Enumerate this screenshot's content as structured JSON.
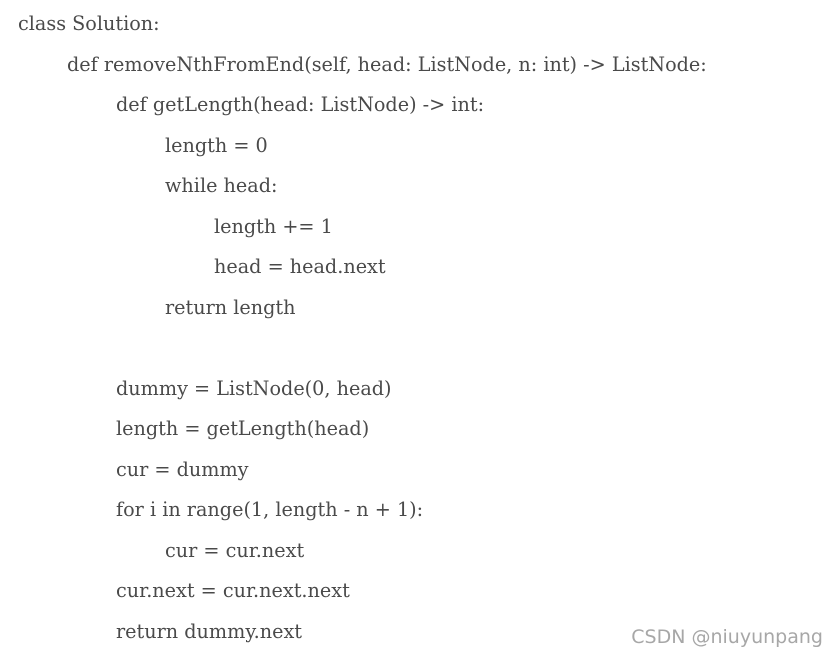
{
  "code": {
    "lines": [
      {
        "text": "class Solution:",
        "indent": 0
      },
      {
        "text": "def removeNthFromEnd(self, head: ListNode, n: int) -> ListNode:",
        "indent": 1
      },
      {
        "text": "def getLength(head: ListNode) -> int:",
        "indent": 2
      },
      {
        "text": "length = 0",
        "indent": 3
      },
      {
        "text": "while head:",
        "indent": 3
      },
      {
        "text": "length += 1",
        "indent": 4
      },
      {
        "text": "head = head.next",
        "indent": 4
      },
      {
        "text": "return length",
        "indent": 3
      },
      {
        "text": "",
        "indent": 0
      },
      {
        "text": "dummy = ListNode(0, head)",
        "indent": 2
      },
      {
        "text": "length = getLength(head)",
        "indent": 2
      },
      {
        "text": "cur = dummy",
        "indent": 2
      },
      {
        "text": "for i in range(1, length - n + 1):",
        "indent": 2
      },
      {
        "text": "cur = cur.next",
        "indent": 3
      },
      {
        "text": "cur.next = cur.next.next",
        "indent": 2
      },
      {
        "text": "return dummy.next",
        "indent": 2
      }
    ]
  },
  "watermark": {
    "text": "CSDN @niuyunpang"
  },
  "colors": {
    "code_text": "#4a4a4a",
    "watermark_text": "#a7a7a7",
    "background": "#ffffff"
  }
}
